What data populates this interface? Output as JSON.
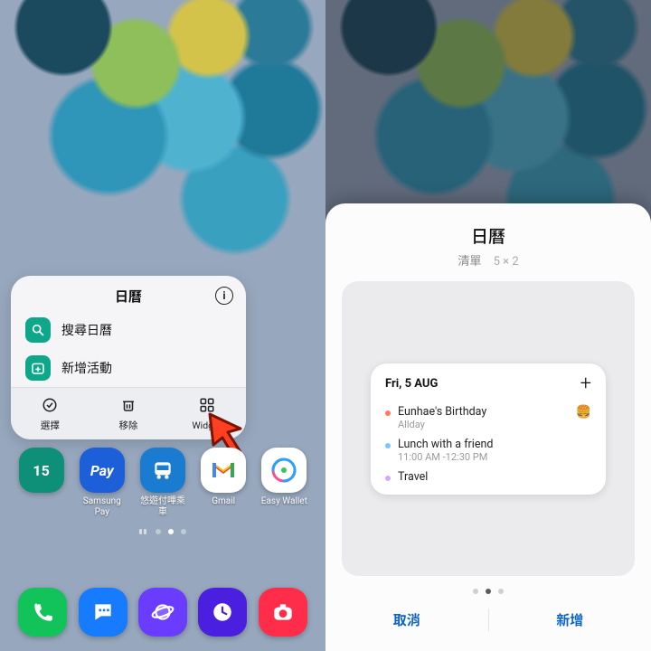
{
  "left": {
    "popup": {
      "title": "日曆",
      "info_aria": "info",
      "items": [
        {
          "icon": "search-icon",
          "label": "搜尋日曆"
        },
        {
          "icon": "add-event-icon",
          "label": "新增活動"
        }
      ],
      "actions": [
        {
          "icon": "select-icon",
          "label": "選擇"
        },
        {
          "icon": "trash-icon",
          "label": "移除"
        },
        {
          "icon": "widget-icon",
          "label": "Widget"
        }
      ]
    },
    "apps": [
      {
        "name": "calendar-15",
        "label": "",
        "digit": "15",
        "bg": "#0d8f78",
        "fg": "#ffffff"
      },
      {
        "name": "samsung-pay",
        "label": "Samsung Pay",
        "text": "Pay",
        "bg": "#1d5fd8",
        "fg": "#ffffff"
      },
      {
        "name": "easycard",
        "label": "悠遊付嗶乘車",
        "bg": "#1a7cd0",
        "fg": "#ffffff",
        "icon": "bus-icon"
      },
      {
        "name": "gmail",
        "label": "Gmail",
        "bg": "#ffffff",
        "fg": "#d93025",
        "icon": "gmail-icon"
      },
      {
        "name": "easy-wallet",
        "label": "Easy Wallet",
        "bg": "#ffffff",
        "fg": "#111",
        "icon": "swirl-icon"
      }
    ],
    "dock": [
      {
        "name": "phone",
        "bg": "#12c35a",
        "icon": "phone-icon"
      },
      {
        "name": "messages",
        "bg": "#167bff",
        "icon": "chat-icon"
      },
      {
        "name": "browser",
        "bg": "#6a3cff",
        "icon": "planet-icon"
      },
      {
        "name": "clock",
        "bg": "#4a1fe0",
        "icon": "clock-icon"
      },
      {
        "name": "camera",
        "bg": "#ff2d4a",
        "icon": "camera-icon"
      }
    ]
  },
  "right": {
    "sheet": {
      "title": "日曆",
      "subtitle_name": "清單",
      "subtitle_size": "5 × 2",
      "cancel": "取消",
      "add": "新增"
    },
    "widget": {
      "date": "Fri, 5 AUG",
      "events": [
        {
          "dot": "#ff7a59",
          "name": "Eunhae's Birthday",
          "time": "Allday",
          "emoji": "🍔"
        },
        {
          "dot": "#7cc4ff",
          "name": "Lunch with a friend",
          "time": "11:00 AM -12:30 PM",
          "emoji": ""
        },
        {
          "dot": "#d7a8ff",
          "name": "Travel",
          "time": "",
          "emoji": ""
        }
      ]
    }
  }
}
